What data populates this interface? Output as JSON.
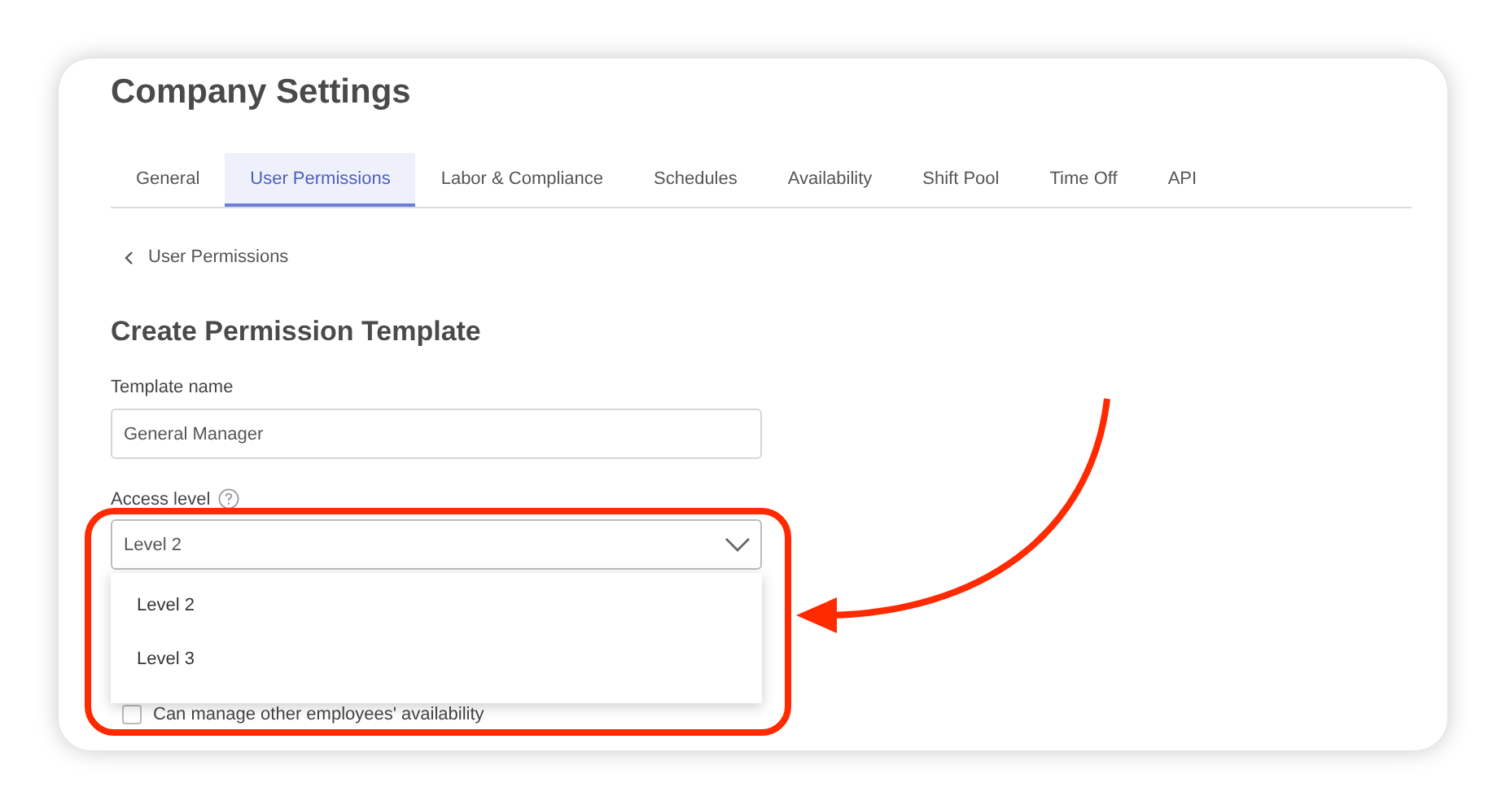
{
  "page": {
    "title": "Company Settings"
  },
  "tabs": [
    {
      "label": "General",
      "selected": false
    },
    {
      "label": "User Permissions",
      "selected": true
    },
    {
      "label": "Labor & Compliance",
      "selected": false
    },
    {
      "label": "Schedules",
      "selected": false
    },
    {
      "label": "Availability",
      "selected": false
    },
    {
      "label": "Shift Pool",
      "selected": false
    },
    {
      "label": "Time Off",
      "selected": false
    },
    {
      "label": "API",
      "selected": false
    }
  ],
  "back_link": {
    "label": "User Permissions"
  },
  "form": {
    "heading": "Create Permission Template",
    "template_name": {
      "label": "Template name",
      "value": "General Manager"
    },
    "access_level": {
      "label": "Access level",
      "value": "Level 2",
      "expanded": true,
      "options": [
        {
          "label": "Level 2"
        },
        {
          "label": "Level 3"
        }
      ]
    },
    "permissions": [
      {
        "label": "Can manage other employees' availability",
        "checked": false
      }
    ]
  }
}
